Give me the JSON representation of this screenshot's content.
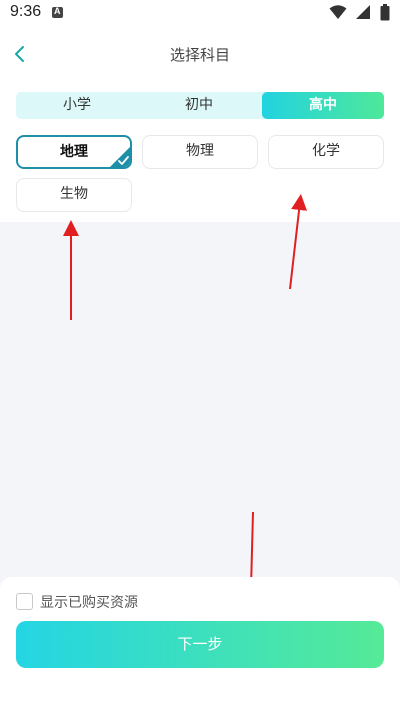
{
  "status_bar": {
    "time": "9:36",
    "icons": [
      "notification-a-icon",
      "wifi-icon",
      "signal-icon",
      "battery-icon"
    ]
  },
  "navbar": {
    "back_icon": "chevron-left-icon",
    "title": "选择科目"
  },
  "levels": {
    "items": [
      {
        "label": "小学",
        "selected": false
      },
      {
        "label": "初中",
        "selected": false
      },
      {
        "label": "高中",
        "selected": true
      }
    ]
  },
  "subjects": {
    "items": [
      {
        "label": "地理",
        "selected": true
      },
      {
        "label": "物理",
        "selected": false
      },
      {
        "label": "化学",
        "selected": false
      },
      {
        "label": "生物",
        "selected": false
      }
    ]
  },
  "footer": {
    "checkbox_label": "显示已购买资源",
    "checkbox_checked": false,
    "next_label": "下一步"
  },
  "colors": {
    "accent_start": "#22d3e0",
    "accent_end": "#4ee89a",
    "selected_border": "#1f8fa8",
    "annotation_arrow": "#e02020"
  }
}
